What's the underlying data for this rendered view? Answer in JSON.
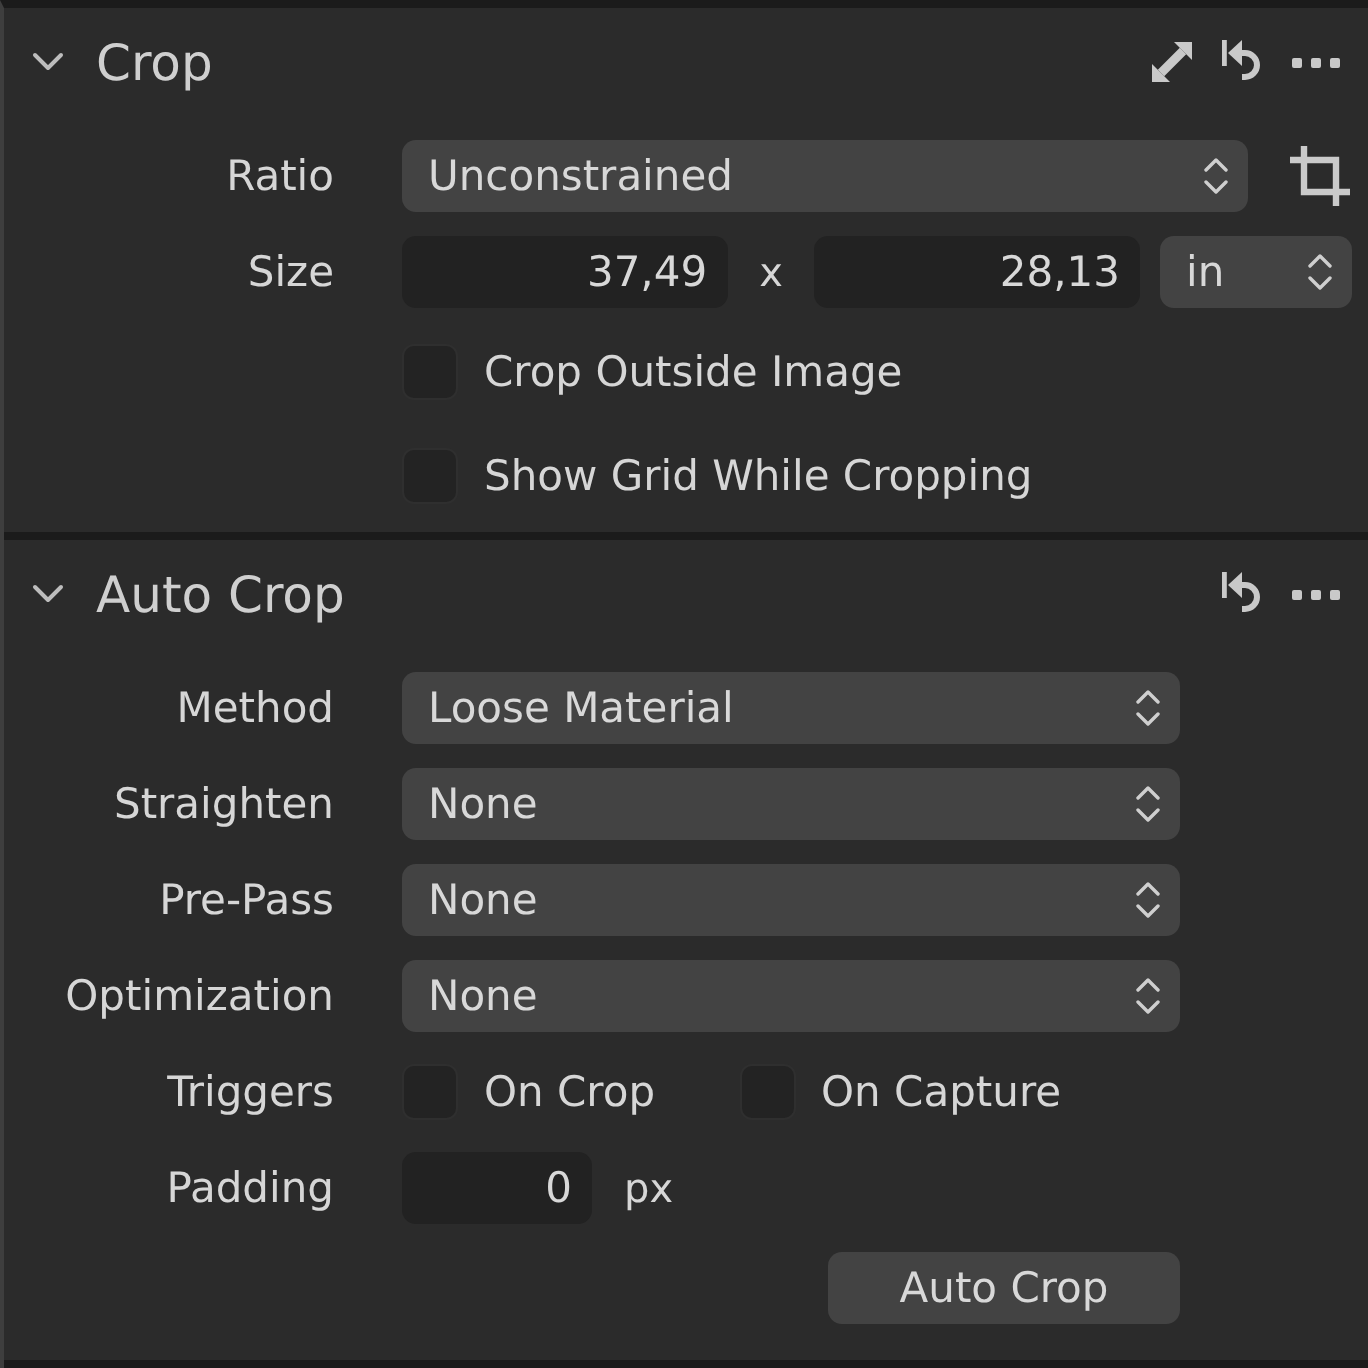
{
  "sections": [
    {
      "title": "Crop",
      "expanded": true,
      "actions": [
        {
          "kind": "expand"
        },
        {
          "kind": "reset"
        },
        {
          "kind": "more"
        }
      ],
      "rows": [
        {
          "label": "Ratio",
          "controls": [
            {
              "kind": "popup",
              "value": "Unconstrained"
            },
            {
              "kind": "tool"
            }
          ]
        },
        {
          "label": "Size",
          "controls": [
            {
              "kind": "number",
              "value": "37,49"
            },
            {
              "kind": "text",
              "text": "x"
            },
            {
              "kind": "number",
              "value": "28,13"
            },
            {
              "kind": "popup",
              "value": "in"
            }
          ]
        },
        {
          "controls": [
            {
              "kind": "checkbox",
              "label": "Crop Outside Image",
              "checked": false
            }
          ]
        },
        {
          "controls": [
            {
              "kind": "checkbox",
              "label": "Show Grid While Cropping",
              "checked": false
            }
          ]
        }
      ]
    },
    {
      "title": "Auto Crop",
      "expanded": true,
      "actions": [
        {
          "kind": "reset"
        },
        {
          "kind": "more"
        }
      ],
      "rows": [
        {
          "label": "Method",
          "controls": [
            {
              "kind": "popup",
              "value": "Loose Material"
            }
          ]
        },
        {
          "label": "Straighten",
          "controls": [
            {
              "kind": "popup",
              "value": "None"
            }
          ]
        },
        {
          "label": "Pre-Pass",
          "controls": [
            {
              "kind": "popup",
              "value": "None"
            }
          ]
        },
        {
          "label": "Optimization",
          "controls": [
            {
              "kind": "popup",
              "value": "None"
            }
          ]
        },
        {
          "label": "Triggers",
          "controls": [
            {
              "kind": "checkbox",
              "label": "On Crop",
              "checked": false
            },
            {
              "kind": "checkbox",
              "label": "On Capture",
              "checked": false
            }
          ]
        },
        {
          "label": "Padding",
          "controls": [
            {
              "kind": "number",
              "value": "0"
            },
            {
              "kind": "text",
              "text": "px"
            }
          ]
        },
        {
          "controls": [
            {
              "kind": "button",
              "label": "Auto Crop"
            }
          ]
        }
      ]
    }
  ]
}
